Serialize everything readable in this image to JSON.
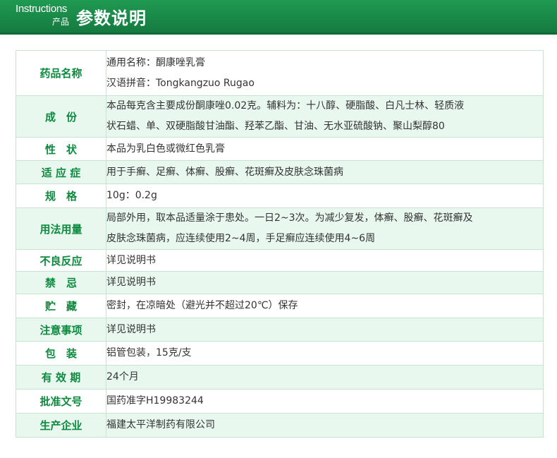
{
  "header": {
    "en_title": "Instructions",
    "cn_small": "产品",
    "cn_title": "参数说明"
  },
  "rows": [
    {
      "label": "药品名称",
      "lines": [
        "通用名称：酮康唑乳膏",
        "汉语拼音：Tongkangzuo Rugao"
      ]
    },
    {
      "label": "成　份",
      "lines": [
        "本品每克含主要成份酮康唑0.02克。辅料为：十八醇、硬脂酸、白凡士林、轻质液",
        "状石蜡、单、双硬脂酸甘油酯、羟苯乙酯、甘油、无水亚硫酸钠、聚山梨醇80"
      ]
    },
    {
      "label": "性　状",
      "lines": [
        "本品为乳白色或微红色乳膏"
      ]
    },
    {
      "label": "适 应 症",
      "lines": [
        "用于手癣、足癣、体癣、股癣、花斑癣及皮肤念珠菌病"
      ]
    },
    {
      "label": "规　格",
      "lines": [
        "10g：0.2g"
      ]
    },
    {
      "label": "用法用量",
      "lines": [
        "局部外用，取本品适量涂于患处。一日2~3次。为减少复发，体癣、股癣、花斑癣及",
        "皮肤念珠菌病，应连续使用2~4周，手足癣应连续使用4~6周"
      ]
    },
    {
      "label": "不良反应",
      "lines": [
        "详见说明书"
      ]
    },
    {
      "label": "禁　忌",
      "lines": [
        "详见说明书"
      ]
    },
    {
      "label": "贮　藏",
      "lines": [
        "密封，在凉暗处（避光并不超过20℃）保存"
      ]
    },
    {
      "label": "注意事项",
      "lines": [
        "详见说明书"
      ]
    },
    {
      "label": "包　装",
      "lines": [
        "铝管包装，15克/支"
      ]
    },
    {
      "label": "有 效 期",
      "lines": [
        "24个月"
      ]
    },
    {
      "label": "批准文号",
      "lines": [
        "国药准字H19983244"
      ]
    },
    {
      "label": "生产企业",
      "lines": [
        "福建太平洋制药有限公司"
      ]
    }
  ]
}
